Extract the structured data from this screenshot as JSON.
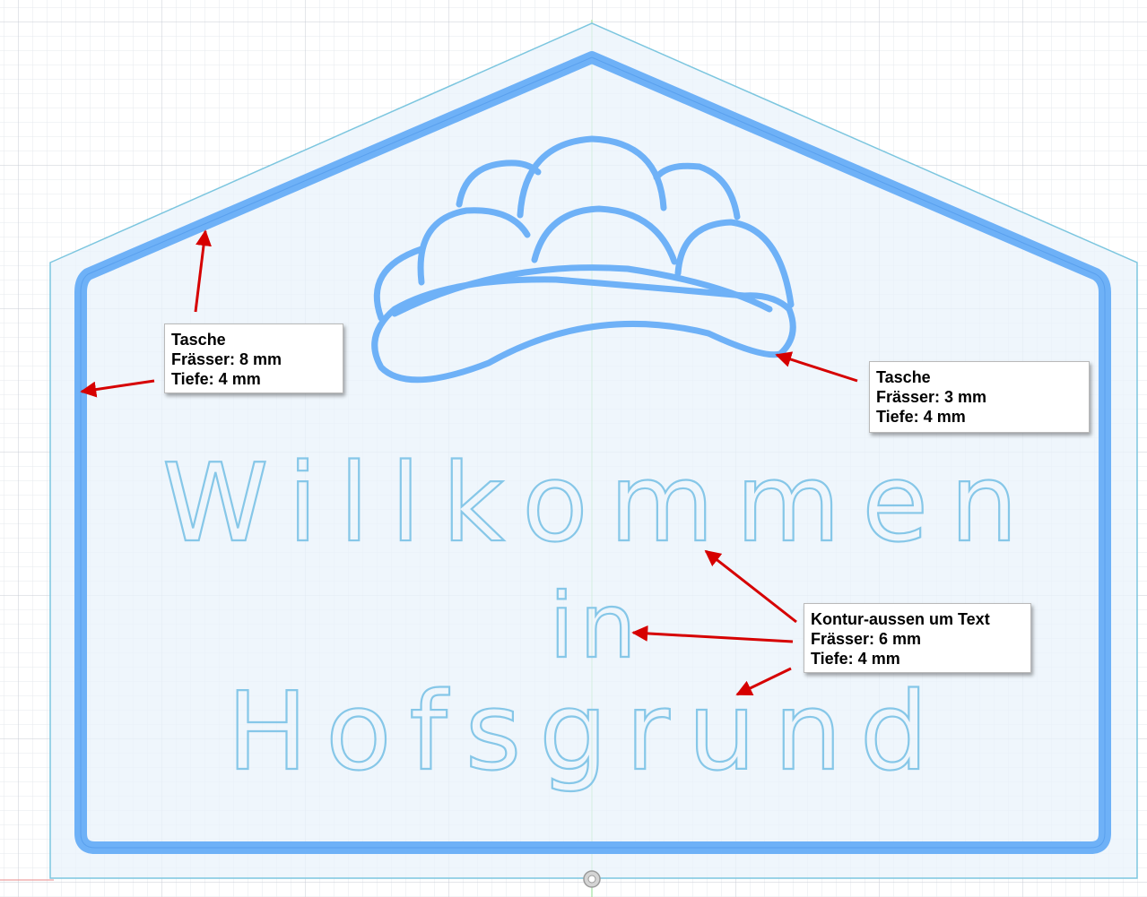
{
  "colors": {
    "grid_minor": "#e6e8ee",
    "grid_major": "#c9ccd6",
    "plate_fill": "#eaf3fb",
    "plate_edge": "#7cc6df",
    "pocket_fill": "#6eb1f7",
    "pocket_edge": "#4b95e8",
    "text_contour": "#86c7e8",
    "axis_green": "#8fdc8f",
    "axis_red": "#e88a8a",
    "arrow": "#d60000"
  },
  "sign_text": {
    "line1": "Willkommen",
    "line2": "in",
    "line3": "Hofsgrund"
  },
  "callouts": [
    {
      "title": "Tasche",
      "tool": "Frässer: 8 mm",
      "depth": "Tiefe: 4 mm"
    },
    {
      "title": "Tasche",
      "tool": "Frässer: 3 mm",
      "depth": "Tiefe: 4 mm"
    },
    {
      "title": "Kontur-aussen um Text",
      "tool": "Frässer: 6 mm",
      "depth": "Tiefe: 4 mm"
    }
  ],
  "icons": {
    "origin": "origin-marker-icon",
    "arrow": "annotation-arrow-icon"
  }
}
